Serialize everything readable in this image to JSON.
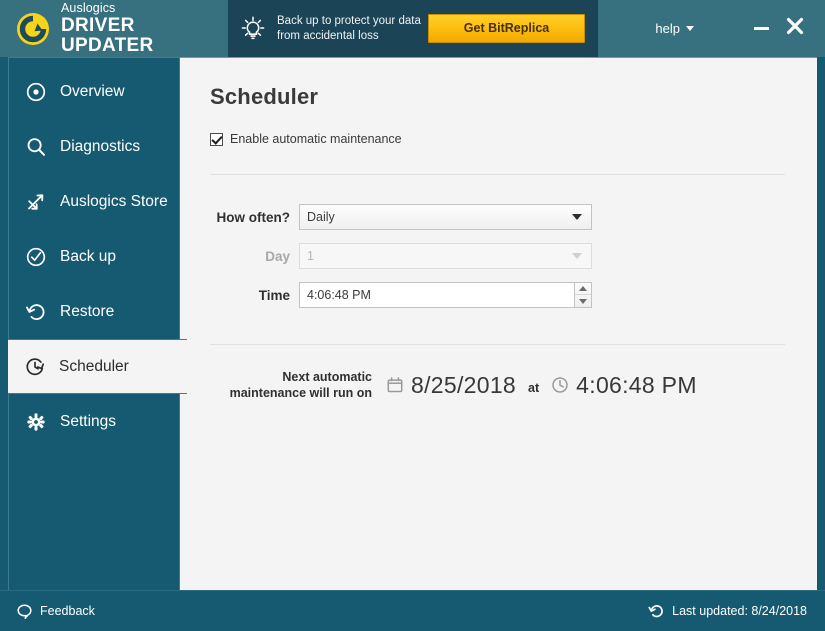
{
  "window": {
    "brand_line1": "Auslogics",
    "brand_line2": "DRIVER UPDATER",
    "help_label": "help",
    "minimize_title": "Minimize",
    "close_title": "Close"
  },
  "promo": {
    "line1": "Back up to protect your data",
    "line2": "from accidental loss",
    "button_label": "Get BitReplica"
  },
  "sidebar": {
    "items": [
      {
        "label": "Overview",
        "icon": "target-icon",
        "active": false
      },
      {
        "label": "Diagnostics",
        "icon": "magnifier-icon",
        "active": false
      },
      {
        "label": "Auslogics Store",
        "icon": "shuffle-arrows-icon",
        "active": false
      },
      {
        "label": "Back up",
        "icon": "check-circle-icon",
        "active": false
      },
      {
        "label": "Restore",
        "icon": "undo-arrow-icon",
        "active": false
      },
      {
        "label": "Scheduler",
        "icon": "clock-icon",
        "active": true
      },
      {
        "label": "Settings",
        "icon": "gear-icon",
        "active": false
      }
    ]
  },
  "main": {
    "title": "Scheduler",
    "enable_checkbox": {
      "label": "Enable automatic maintenance",
      "checked": true
    },
    "form": {
      "how_often": {
        "label": "How often?",
        "value": "Daily",
        "enabled": true
      },
      "day": {
        "label": "Day",
        "value": "1",
        "enabled": false
      },
      "time": {
        "label": "Time",
        "value": "4:06:48 PM",
        "enabled": true
      }
    },
    "next_run": {
      "label_line1": "Next automatic",
      "label_line2": "maintenance will run on",
      "date": "8/25/2018",
      "at": "at",
      "time": "4:06:48 PM"
    }
  },
  "footer": {
    "feedback_label": "Feedback",
    "last_updated_label": "Last updated: 8/24/2018"
  },
  "colors": {
    "sidebar_teal": "#155a70",
    "header_slate": "#37707e",
    "promo_navy": "#1b4456",
    "accent_gold": "#fdc113",
    "content_bg": "#f4f4f4"
  }
}
